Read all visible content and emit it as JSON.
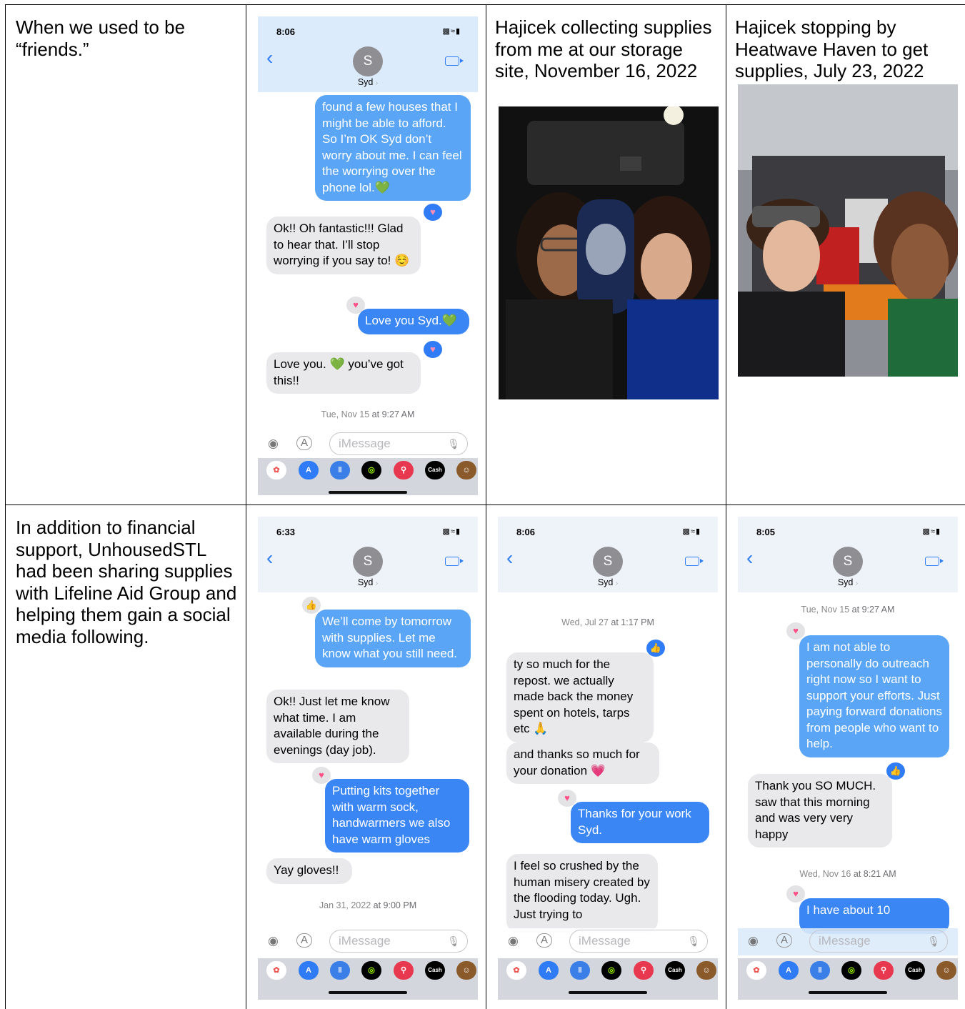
{
  "captions": {
    "friends": "When we used to be “friends.”",
    "storage": "Hajicek collecting supplies from me at our storage site, November 16, 2022",
    "heatwave": "Hajicek stopping by Heatwave Haven to get supplies, July 23, 2022",
    "support": "In addition to financial support, UnhousedSTL had been sharing supplies with Lifeline Aid Group and helping them gain a social media following."
  },
  "phone1": {
    "time": "8:06",
    "avatar": "S",
    "name": "Syd",
    "m1": "found a few houses that I might be able to afford. So I’m OK Syd don’t worry about me. I can feel the worrying over the phone lol.💚",
    "m2": "Ok!! Oh fantastic!!! Glad to hear that. I’ll stop worrying if you say to! ☺️",
    "m3": "Love you Syd.💚",
    "m4": "Love you. 💚 you’ve got this!!",
    "ts_day": "Tue, Nov 15",
    "ts_time": "at 9:27 AM",
    "input_placeholder": "iMessage"
  },
  "phone2": {
    "time": "6:33",
    "avatar": "S",
    "name": "Syd",
    "m1": "We’ll come by tomorrow with supplies. Let me know what you still need.",
    "m2": "Ok!! Just let me know what time. I am available during the evenings (day job).",
    "m3": "Putting kits together with warm sock, handwarmers we also have warm gloves",
    "m4": "Yay gloves!!",
    "ts_day": "Jan 31, 2022",
    "ts_time": "at 9:00 PM",
    "input_placeholder": "iMessage"
  },
  "phone3": {
    "time": "8:06",
    "avatar": "S",
    "name": "Syd",
    "ts_day": "Wed, Jul 27",
    "ts_time": "at 1:17 PM",
    "m1": "ty so much for the repost. we actually made back the money spent on hotels, tarps etc 🙏",
    "m2": "and thanks so much for your donation 💗",
    "m3": "Thanks for your work Syd.",
    "m4": "I feel so crushed by the human misery created by the flooding today. Ugh. Just trying to",
    "input_placeholder": "iMessage"
  },
  "phone4": {
    "time": "8:05",
    "avatar": "S",
    "name": "Syd",
    "ts1_day": "Tue, Nov 15",
    "ts1_time": "at 9:27 AM",
    "m1": "I am not able to personally do outreach right now so I want to support your efforts. Just paying forward donations from people who want to help.",
    "m2": "Thank you SO MUCH. saw that this morning and was very very happy",
    "ts2_day": "Wed, Nov 16",
    "ts2_time": "at 8:21 AM",
    "m3": "I have about 10",
    "input_placeholder": "iMessage"
  },
  "tray_apps": [
    "photos-icon",
    "app-store-icon",
    "audio-icon",
    "activity-icon",
    "search-images-icon",
    "apple-cash-icon",
    "memoji-icon"
  ],
  "tray_cash_label": "Cash"
}
